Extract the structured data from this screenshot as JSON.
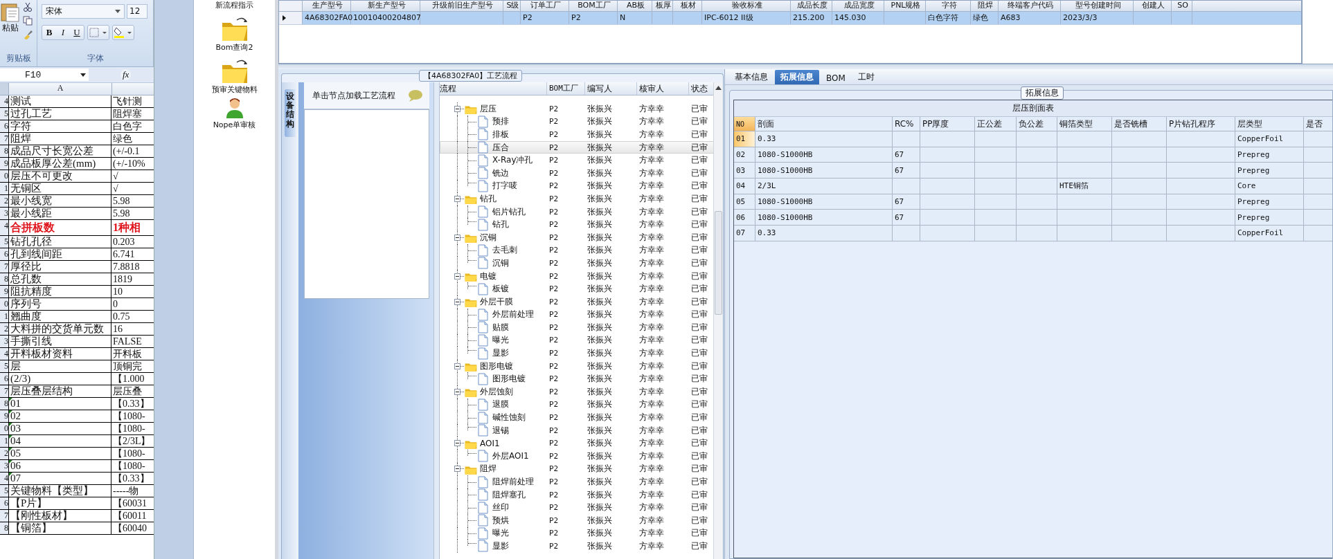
{
  "spreadsheet": {
    "clipboard": {
      "paste_label": "粘贴",
      "group_label": "剪贴板"
    },
    "font": {
      "name": "宋体",
      "size": "12",
      "bold": "B",
      "italic": "I",
      "underline": "U",
      "group_label": "字体"
    },
    "name_box": "F10",
    "formula_label": "fx",
    "column_header": "A",
    "rows": [
      {
        "number": "4",
        "label": "测试",
        "value": "飞针测",
        "emphasis": false,
        "flag": false
      },
      {
        "number": "5",
        "label": "过孔工艺",
        "value": "阻焊塞",
        "emphasis": false,
        "flag": false
      },
      {
        "number": "6",
        "label": "字符",
        "value": "白色字",
        "emphasis": false,
        "flag": false
      },
      {
        "number": "7",
        "label": "阻焊",
        "value": "绿色",
        "emphasis": false,
        "flag": false
      },
      {
        "number": "8",
        "label": "成品尺寸长宽公差",
        "value": "(+/-0.1",
        "emphasis": false,
        "flag": false
      },
      {
        "number": "9",
        "label": "成品板厚公差(mm)",
        "value": "(+/-10%",
        "emphasis": false,
        "flag": false
      },
      {
        "number": "0",
        "label": "层压不可更改",
        "value": "√",
        "emphasis": false,
        "flag": false
      },
      {
        "number": "1",
        "label": "无铜区",
        "value": "√",
        "emphasis": false,
        "flag": false
      },
      {
        "number": "2",
        "label": "最小线宽",
        "value": "5.98",
        "emphasis": false,
        "flag": false
      },
      {
        "number": "3",
        "label": "最小线距",
        "value": "5.98",
        "emphasis": false,
        "flag": false
      },
      {
        "number": "4",
        "label": "合拼板数",
        "value": "1种相",
        "emphasis": true,
        "flag": false
      },
      {
        "number": "5",
        "label": "钻孔孔径",
        "value": "0.203",
        "emphasis": false,
        "flag": false
      },
      {
        "number": "6",
        "label": "孔到线间距",
        "value": "6.741",
        "emphasis": false,
        "flag": false
      },
      {
        "number": "7",
        "label": "厚径比",
        "value": "7.8818",
        "emphasis": false,
        "flag": false
      },
      {
        "number": "8",
        "label": "总孔数",
        "value": "1819",
        "emphasis": false,
        "flag": false
      },
      {
        "number": "9",
        "label": "阻抗精度",
        "value": "10",
        "emphasis": false,
        "flag": false
      },
      {
        "number": "0",
        "label": "序列号",
        "value": "0",
        "emphasis": false,
        "flag": false
      },
      {
        "number": "1",
        "label": "翘曲度",
        "value": "0.75",
        "emphasis": false,
        "flag": false
      },
      {
        "number": "2",
        "label": "大料拼的交货单元数",
        "value": "16",
        "emphasis": false,
        "flag": false
      },
      {
        "number": "3",
        "label": "手撕引线",
        "value": "FALSE",
        "emphasis": false,
        "flag": false
      },
      {
        "number": "4",
        "label": "开料板材资料",
        "value": "开料板",
        "emphasis": false,
        "flag": false
      },
      {
        "number": "5",
        "label": "层",
        "value": "顶铜完",
        "emphasis": false,
        "flag": false
      },
      {
        "number": "6",
        "label": "(2/3)",
        "value": "【1.000",
        "emphasis": false,
        "flag": false
      },
      {
        "number": "7",
        "label": "层压叠层结构",
        "value": "层压叠",
        "emphasis": false,
        "flag": false
      },
      {
        "number": "8",
        "label": "01",
        "value": "【0.33】",
        "emphasis": false,
        "flag": true
      },
      {
        "number": "9",
        "label": "02",
        "value": "【1080-",
        "emphasis": false,
        "flag": true
      },
      {
        "number": "0",
        "label": "03",
        "value": "【1080-",
        "emphasis": false,
        "flag": true
      },
      {
        "number": "1",
        "label": "04",
        "value": "【2/3L】",
        "emphasis": false,
        "flag": true
      },
      {
        "number": "2",
        "label": "05",
        "value": "【1080-",
        "emphasis": false,
        "flag": true
      },
      {
        "number": "3",
        "label": "06",
        "value": "【1080-",
        "emphasis": false,
        "flag": true
      },
      {
        "number": "4",
        "label": "07",
        "value": "【0.33】",
        "emphasis": false,
        "flag": true
      },
      {
        "number": "5",
        "label": "关键物料【类型】",
        "value": "-----物",
        "emphasis": false,
        "flag": false
      },
      {
        "number": "6",
        "label": "【P片】",
        "value": "【60031",
        "emphasis": false,
        "flag": false
      },
      {
        "number": "7",
        "label": "【刚性板材】",
        "value": "【60011",
        "emphasis": false,
        "flag": false
      },
      {
        "number": "8",
        "label": "【铜箔】",
        "value": "【60040",
        "emphasis": false,
        "flag": false
      }
    ]
  },
  "launcher": {
    "top_label": "新流程指示",
    "items": [
      {
        "label": "Bom查询2",
        "kind": "folder"
      },
      {
        "label": "预审关键物料",
        "kind": "folder"
      },
      {
        "label": "Nope单审核",
        "kind": "person"
      }
    ]
  },
  "model_grid": {
    "columns": [
      "生产型号",
      "新生产型号",
      "升级前旧生产型号",
      "S级",
      "订单工厂",
      "BOM工厂",
      "AB板",
      "板厚",
      "板材",
      "验收标准",
      "成品长度",
      "成品宽度",
      "PNL规格",
      "字符",
      "阻焊",
      "终端客户代码",
      "型号创建时间",
      "创建人",
      "SO"
    ],
    "rows": [
      {
        "selected": true,
        "cells": [
          "4A68302FA0",
          "10010400204807",
          "",
          "",
          "P2",
          "P2",
          "N",
          "",
          "",
          "IPC-6012 II级",
          "215.200",
          "145.030",
          "",
          "白色字符",
          "绿色",
          "A683",
          "2023/3/3",
          "",
          ""
        ]
      }
    ]
  },
  "process_panel": {
    "title": "【4A68302FA0】工艺流程",
    "side_tab": "设备结构",
    "hint": "单击节点加载工艺流程",
    "tree": {
      "columns": [
        "流程",
        "BOM工厂",
        "编写人",
        "核审人",
        "状态"
      ],
      "nodes": [
        {
          "name": "层压",
          "factory": "P2",
          "writer": "张振兴",
          "reviewer": "方幸幸",
          "status": "已审",
          "expanded": true,
          "selected": false,
          "children": [
            {
              "name": "预排",
              "factory": "P2",
              "writer": "张振兴",
              "reviewer": "方幸幸",
              "status": "已审",
              "selected": false
            },
            {
              "name": "排板",
              "factory": "P2",
              "writer": "张振兴",
              "reviewer": "方幸幸",
              "status": "已审",
              "selected": false
            },
            {
              "name": "压合",
              "factory": "P2",
              "writer": "张振兴",
              "reviewer": "方幸幸",
              "status": "已审",
              "selected": true
            },
            {
              "name": "X-Ray冲孔",
              "factory": "P2",
              "writer": "张振兴",
              "reviewer": "方幸幸",
              "status": "已审",
              "selected": false
            },
            {
              "name": "铣边",
              "factory": "P2",
              "writer": "张振兴",
              "reviewer": "方幸幸",
              "status": "已审",
              "selected": false
            },
            {
              "name": "打字唛",
              "factory": "P2",
              "writer": "张振兴",
              "reviewer": "方幸幸",
              "status": "已审",
              "selected": false
            }
          ]
        },
        {
          "name": "钻孔",
          "factory": "P2",
          "writer": "张振兴",
          "reviewer": "方幸幸",
          "status": "已审",
          "expanded": true,
          "selected": false,
          "children": [
            {
              "name": "铝片钻孔",
              "factory": "P2",
              "writer": "张振兴",
              "reviewer": "方幸幸",
              "status": "已审",
              "selected": false
            },
            {
              "name": "钻孔",
              "factory": "P2",
              "writer": "张振兴",
              "reviewer": "方幸幸",
              "status": "已审",
              "selected": false
            }
          ]
        },
        {
          "name": "沉铜",
          "factory": "P2",
          "writer": "张振兴",
          "reviewer": "方幸幸",
          "status": "已审",
          "expanded": true,
          "selected": false,
          "children": [
            {
              "name": "去毛刺",
              "factory": "P2",
              "writer": "张振兴",
              "reviewer": "方幸幸",
              "status": "已审",
              "selected": false
            },
            {
              "name": "沉铜",
              "factory": "P2",
              "writer": "张振兴",
              "reviewer": "方幸幸",
              "status": "已审",
              "selected": false
            }
          ]
        },
        {
          "name": "电镀",
          "factory": "P2",
          "writer": "张振兴",
          "reviewer": "方幸幸",
          "status": "已审",
          "expanded": true,
          "selected": false,
          "children": [
            {
              "name": "板镀",
              "factory": "P2",
              "writer": "张振兴",
              "reviewer": "方幸幸",
              "status": "已审",
              "selected": false
            }
          ]
        },
        {
          "name": "外层干膜",
          "factory": "P2",
          "writer": "张振兴",
          "reviewer": "方幸幸",
          "status": "已审",
          "expanded": true,
          "selected": false,
          "children": [
            {
              "name": "外层前处理",
              "factory": "P2",
              "writer": "张振兴",
              "reviewer": "方幸幸",
              "status": "已审",
              "selected": false
            },
            {
              "name": "贴膜",
              "factory": "P2",
              "writer": "张振兴",
              "reviewer": "方幸幸",
              "status": "已审",
              "selected": false
            },
            {
              "name": "曝光",
              "factory": "P2",
              "writer": "张振兴",
              "reviewer": "方幸幸",
              "status": "已审",
              "selected": false
            },
            {
              "name": "显影",
              "factory": "P2",
              "writer": "张振兴",
              "reviewer": "方幸幸",
              "status": "已审",
              "selected": false
            }
          ]
        },
        {
          "name": "图形电镀",
          "factory": "P2",
          "writer": "张振兴",
          "reviewer": "方幸幸",
          "status": "已审",
          "expanded": true,
          "selected": false,
          "children": [
            {
              "name": "图形电镀",
              "factory": "P2",
              "writer": "张振兴",
              "reviewer": "方幸幸",
              "status": "已审",
              "selected": false
            }
          ]
        },
        {
          "name": "外层蚀刻",
          "factory": "P2",
          "writer": "张振兴",
          "reviewer": "方幸幸",
          "status": "已审",
          "expanded": true,
          "selected": false,
          "children": [
            {
              "name": "退膜",
              "factory": "P2",
              "writer": "张振兴",
              "reviewer": "方幸幸",
              "status": "已审",
              "selected": false
            },
            {
              "name": "碱性蚀刻",
              "factory": "P2",
              "writer": "张振兴",
              "reviewer": "方幸幸",
              "status": "已审",
              "selected": false
            },
            {
              "name": "退锡",
              "factory": "P2",
              "writer": "张振兴",
              "reviewer": "方幸幸",
              "status": "已审",
              "selected": false
            }
          ]
        },
        {
          "name": "AOI1",
          "factory": "P2",
          "writer": "张振兴",
          "reviewer": "方幸幸",
          "status": "已审",
          "expanded": true,
          "selected": false,
          "children": [
            {
              "name": "外层AOI1",
              "factory": "P2",
              "writer": "张振兴",
              "reviewer": "方幸幸",
              "status": "已审",
              "selected": false
            }
          ]
        },
        {
          "name": "阻焊",
          "factory": "P2",
          "writer": "张振兴",
          "reviewer": "方幸幸",
          "status": "已审",
          "expanded": true,
          "selected": false,
          "children": [
            {
              "name": "阻焊前处理",
              "factory": "P2",
              "writer": "张振兴",
              "reviewer": "方幸幸",
              "status": "已审",
              "selected": false
            },
            {
              "name": "阻焊塞孔",
              "factory": "P2",
              "writer": "张振兴",
              "reviewer": "方幸幸",
              "status": "已审",
              "selected": false
            },
            {
              "name": "丝印",
              "factory": "P2",
              "writer": "张振兴",
              "reviewer": "方幸幸",
              "status": "已审",
              "selected": false
            },
            {
              "name": "预烘",
              "factory": "P2",
              "writer": "张振兴",
              "reviewer": "方幸幸",
              "status": "已审",
              "selected": false
            },
            {
              "name": "曝光",
              "factory": "P2",
              "writer": "张振兴",
              "reviewer": "方幸幸",
              "status": "已审",
              "selected": false
            },
            {
              "name": "显影",
              "factory": "P2",
              "writer": "张振兴",
              "reviewer": "方幸幸",
              "status": "已审",
              "selected": false
            }
          ]
        }
      ]
    }
  },
  "detail_panel": {
    "tabs": [
      {
        "label": "基本信息",
        "selected": false
      },
      {
        "label": "拓展信息",
        "selected": true
      },
      {
        "label": "BOM",
        "selected": false
      },
      {
        "label": "工时",
        "selected": false
      }
    ],
    "group_title": "拓展信息",
    "table": {
      "title": "层压剖面表",
      "columns": [
        "NO",
        "剖面",
        "RC%",
        "PP厚度",
        "正公差",
        "负公差",
        "铜箔类型",
        "是否铣槽",
        "P片钻孔程序",
        "层类型",
        "是否"
      ],
      "rows": [
        {
          "selected": true,
          "cells": [
            "01",
            "0.33",
            "",
            "",
            "",
            "",
            "",
            "",
            "",
            "CopperFoil",
            ""
          ]
        },
        {
          "selected": false,
          "cells": [
            "02",
            "1080-S1000HB",
            "67",
            "",
            "",
            "",
            "",
            "",
            "",
            "Prepreg",
            ""
          ]
        },
        {
          "selected": false,
          "cells": [
            "03",
            "1080-S1000HB",
            "67",
            "",
            "",
            "",
            "",
            "",
            "",
            "Prepreg",
            ""
          ]
        },
        {
          "selected": false,
          "cells": [
            "04",
            "2/3L",
            "",
            "",
            "",
            "",
            "HTE铜箔",
            "",
            "",
            "Core",
            ""
          ]
        },
        {
          "selected": false,
          "cells": [
            "05",
            "1080-S1000HB",
            "67",
            "",
            "",
            "",
            "",
            "",
            "",
            "Prepreg",
            ""
          ]
        },
        {
          "selected": false,
          "cells": [
            "06",
            "1080-S1000HB",
            "67",
            "",
            "",
            "",
            "",
            "",
            "",
            "Prepreg",
            ""
          ]
        },
        {
          "selected": false,
          "cells": [
            "07",
            "0.33",
            "",
            "",
            "",
            "",
            "",
            "",
            "",
            "CopperFoil",
            ""
          ]
        }
      ]
    }
  }
}
